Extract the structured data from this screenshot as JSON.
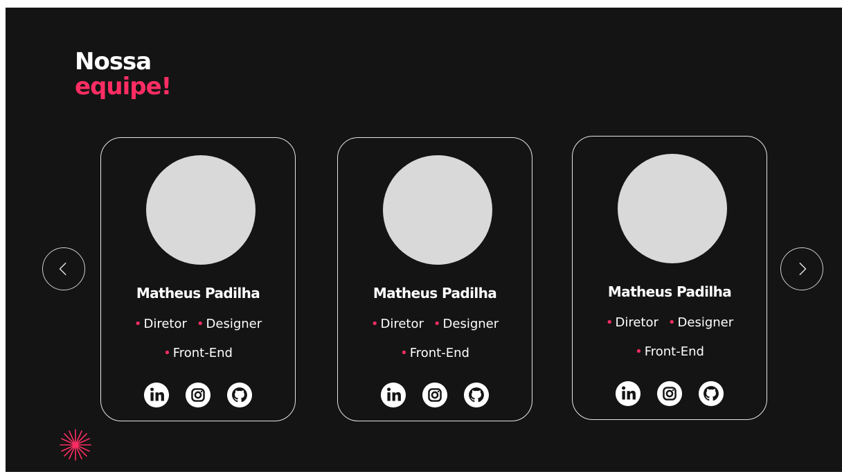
{
  "section": {
    "title_line1": "Nossa",
    "title_line2": "equipe!"
  },
  "team": [
    {
      "name": "Matheus Padilha",
      "roles": [
        "Diretor",
        "Designer",
        "Front-End"
      ],
      "socials": [
        "linkedin-icon",
        "instagram-icon",
        "github-icon"
      ]
    },
    {
      "name": "Matheus Padilha",
      "roles": [
        "Diretor",
        "Designer",
        "Front-End"
      ],
      "socials": [
        "linkedin-icon",
        "instagram-icon",
        "github-icon"
      ]
    },
    {
      "name": "Matheus Padilha",
      "roles": [
        "Diretor",
        "Designer",
        "Front-End"
      ],
      "socials": [
        "linkedin-icon",
        "instagram-icon",
        "github-icon"
      ]
    }
  ],
  "carousel": {
    "prev_icon": "chevron-left-icon",
    "next_icon": "chevron-right-icon"
  },
  "decoration": {
    "icon": "sparkle-icon"
  },
  "colors": {
    "background": "#141414",
    "accent": "#ff2d63",
    "text": "#ffffff",
    "avatar_placeholder": "#d9d9d9"
  }
}
